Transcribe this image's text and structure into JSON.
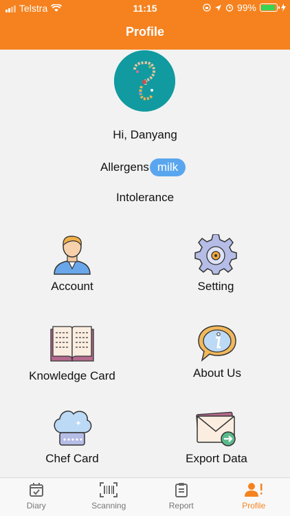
{
  "status": {
    "carrier": "Telstra",
    "time": "11:15",
    "battery": "99%",
    "battery_level": 0.99
  },
  "header": {
    "title": "Profile"
  },
  "profile": {
    "greeting": "Hi, Danyang",
    "allergens_label": "Allergens",
    "allergens": [
      "milk"
    ],
    "intolerance_label": "Intolerance"
  },
  "menu": {
    "account": "Account",
    "setting": "Setting",
    "knowledge": "Knowledge Card",
    "about": "About Us",
    "chef": "Chef Card",
    "export": "Export Data"
  },
  "tabs": {
    "diary": "Diary",
    "scanning": "Scanning",
    "report": "Report",
    "profile": "Profile"
  },
  "colors": {
    "accent": "#f5821f",
    "chip": "#5aa6ee",
    "avatar_bg": "#119aa0"
  }
}
